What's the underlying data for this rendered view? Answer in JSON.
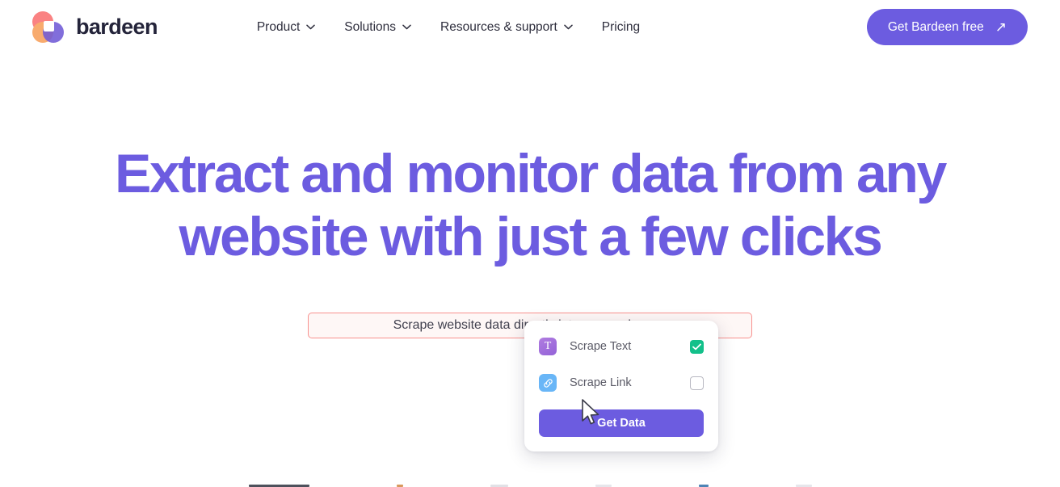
{
  "header": {
    "brand_name": "bardeen",
    "logo_icon": "bardeen-logo-icon",
    "nav": [
      {
        "label": "Product",
        "has_chevron": true,
        "icon": "chevron-down-icon"
      },
      {
        "label": "Solutions",
        "has_chevron": true,
        "icon": "chevron-down-icon"
      },
      {
        "label": "Resources & support",
        "has_chevron": true,
        "icon": "chevron-down-icon"
      },
      {
        "label": "Pricing",
        "has_chevron": false,
        "icon": ""
      }
    ],
    "cta_label": "Get Bardeen free",
    "cta_icon": "arrow-up-right-icon"
  },
  "hero": {
    "headline_line1": "Extract and monitor data from any",
    "headline_line2": "website with just a few clicks",
    "subtitle": "Scrape website data directly into your web apps"
  },
  "dropdown": {
    "options": [
      {
        "label": "Scrape Text",
        "icon": "text-icon",
        "icon_glyph": "T",
        "checked": true,
        "checkbox_icon": "checkmark-icon"
      },
      {
        "label": "Scrape Link",
        "icon": "link-icon",
        "icon_glyph": "",
        "checked": false,
        "checkbox_icon": ""
      }
    ],
    "submit_label": "Get Data"
  },
  "cursor": {
    "icon": "mouse-pointer-icon"
  },
  "colors": {
    "brand_purple": "#6c5ce0",
    "headline_purple": "#6c5ce0",
    "subbox_border": "#f8918e",
    "subbox_background": "#fef7f6",
    "checkbox_checked": "#13c08a",
    "text_icon_purple": "#9463d8",
    "link_icon_blue": "#69b6f7",
    "page_background": "#ffffff"
  }
}
